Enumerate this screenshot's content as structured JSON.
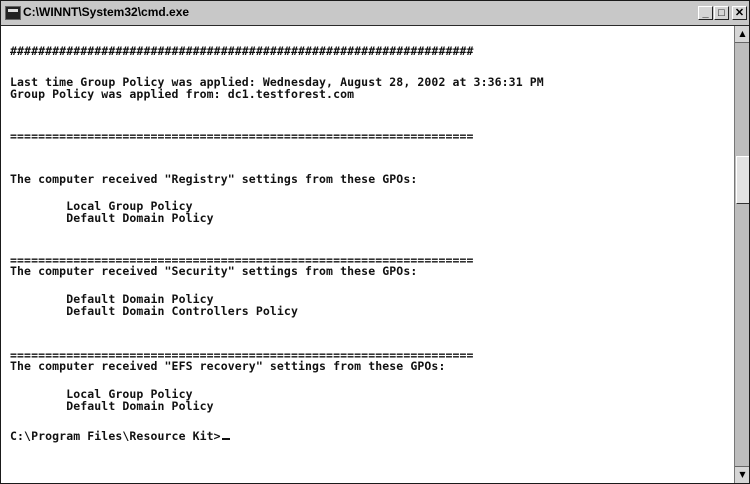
{
  "window": {
    "title": "C:\\WINNT\\System32\\cmd.exe",
    "minimize_glyph": "_",
    "maximize_glyph": "□",
    "close_glyph": "✕",
    "icon": "console-icon"
  },
  "console": {
    "hash_line": "##################################################################",
    "last_applied": "Last time Group Policy was applied: Wednesday, August 28, 2002 at 3:36:31 PM",
    "applied_from": "Group Policy was applied from: dc1.testforest.com",
    "separator": "==================================================================",
    "registry_heading": "The computer received \"Registry\" settings from these GPOs:",
    "registry_gpos": [
      "        Local Group Policy",
      "        Default Domain Policy"
    ],
    "security_heading": "The computer received \"Security\" settings from these GPOs:",
    "security_gpos": [
      "        Default Domain Policy",
      "        Default Domain Controllers Policy"
    ],
    "efs_heading": "The computer received \"EFS recovery\" settings from these GPOs:",
    "efs_gpos": [
      "        Local Group Policy",
      "        Default Domain Policy"
    ],
    "prompt": "C:\\Program Files\\Resource Kit>"
  },
  "scrollbar": {
    "up_glyph": "▲",
    "down_glyph": "▼"
  }
}
